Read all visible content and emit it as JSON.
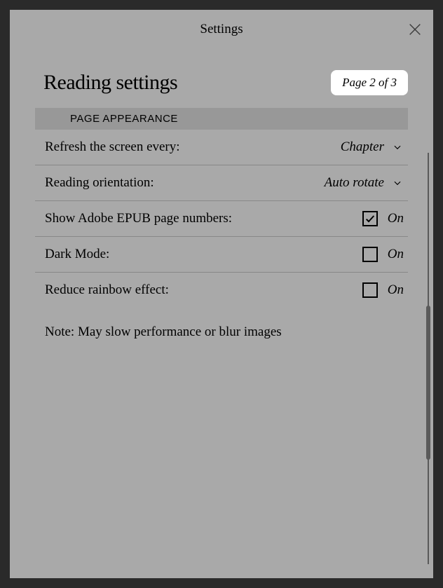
{
  "modal": {
    "title": "Settings"
  },
  "page": {
    "title": "Reading settings",
    "badge": "Page 2 of 3"
  },
  "section": {
    "header": "PAGE APPEARANCE"
  },
  "rows": {
    "refresh": {
      "label": "Refresh the screen every:",
      "value": "Chapter"
    },
    "orientation": {
      "label": "Reading orientation:",
      "value": "Auto rotate"
    },
    "adobe": {
      "label": "Show Adobe EPUB page numbers:",
      "value": "On",
      "checked": true
    },
    "darkmode": {
      "label": "Dark Mode:",
      "value": "On",
      "checked": false
    },
    "rainbow": {
      "label": "Reduce rainbow effect:",
      "value": "On",
      "checked": false
    }
  },
  "note": "Note: May slow performance or blur images"
}
